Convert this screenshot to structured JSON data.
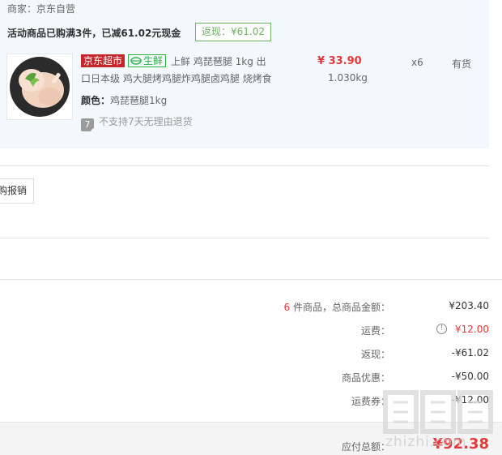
{
  "merchant": {
    "label": "商家：",
    "name": "京东自营"
  },
  "promo": {
    "text": "活动商品已购满3件，已减61.02元现金",
    "rebate": "返现：¥61.02"
  },
  "product": {
    "tag_jd": "京东超市",
    "tag_fresh": "生鲜",
    "title_line1": "上鲜 鸡琵琶腿 1kg 出",
    "title_line2": "口日本级 鸡大腿烤鸡腿炸鸡腿卤鸡腿 烧烤食",
    "color_label": "颜色：",
    "color_value": "鸡琵琶腿1kg",
    "return_badge": "7",
    "return_text": "不支持7天无理由退货",
    "price": "¥ 33.90",
    "weight": "1.030kg",
    "quantity": "x6",
    "stock": "有货"
  },
  "invoice": {
    "label": "购报销"
  },
  "summary": {
    "count": "6",
    "count_suffix": " 件商品，总商品金额：",
    "total_goods": "¥203.40",
    "shipping_label": "运费：",
    "shipping_value": "¥12.00",
    "cashback_label": "返现：",
    "cashback_value": "-¥61.02",
    "discount_label": "商品优惠：",
    "discount_value": "-¥50.00",
    "coupon_label": "运费券：",
    "coupon_value": "-¥12.00",
    "payable_label": "应付总额：",
    "payable_value": "¥92.38"
  },
  "watermark": {
    "text": "zhizhi.com",
    "brand": "值值值"
  },
  "colors": {
    "accent_red": "#e4393c",
    "green": "#6fb262",
    "panel_bg": "#f3f8fe"
  }
}
